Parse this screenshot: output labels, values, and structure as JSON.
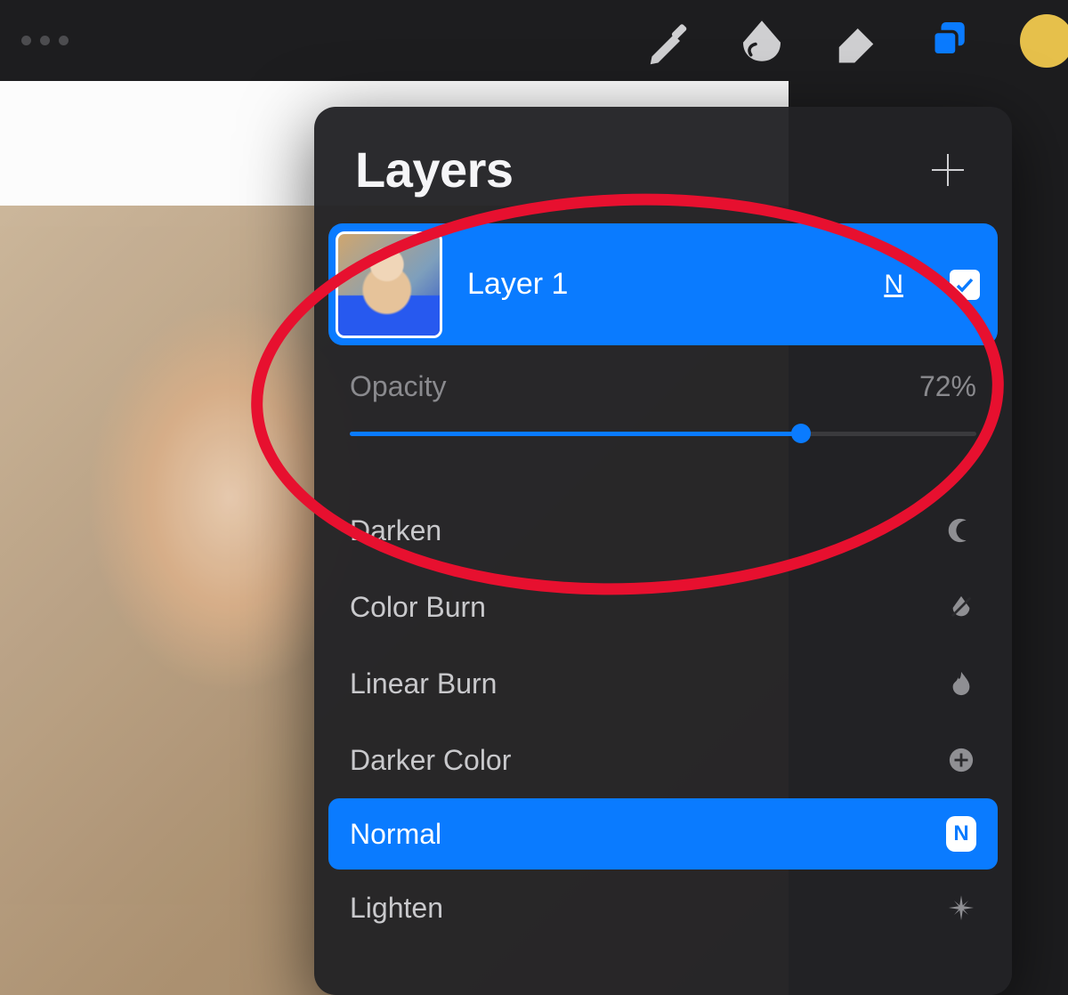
{
  "toolbar": {
    "tools": [
      "brush",
      "smudge",
      "eraser",
      "layers"
    ],
    "active_tool": "layers",
    "swatch_color": "#e6c04b"
  },
  "panel": {
    "title": "Layers",
    "add_label": "Add layer"
  },
  "layer": {
    "name": "Layer 1",
    "blend_letter": "N",
    "visible": true
  },
  "opacity": {
    "label": "Opacity",
    "value_text": "72%",
    "value": 72
  },
  "blend_modes": [
    {
      "label": "Darken",
      "icon": "moon",
      "selected": false
    },
    {
      "label": "Color Burn",
      "icon": "droplet",
      "selected": false
    },
    {
      "label": "Linear Burn",
      "icon": "flame",
      "selected": false
    },
    {
      "label": "Darker Color",
      "icon": "plus-dot",
      "selected": false
    },
    {
      "label": "Normal",
      "icon": "badge-n",
      "selected": true
    },
    {
      "label": "Lighten",
      "icon": "sparkle",
      "selected": false
    }
  ],
  "annotation": {
    "shape": "ellipse",
    "color": "#e7102f"
  }
}
